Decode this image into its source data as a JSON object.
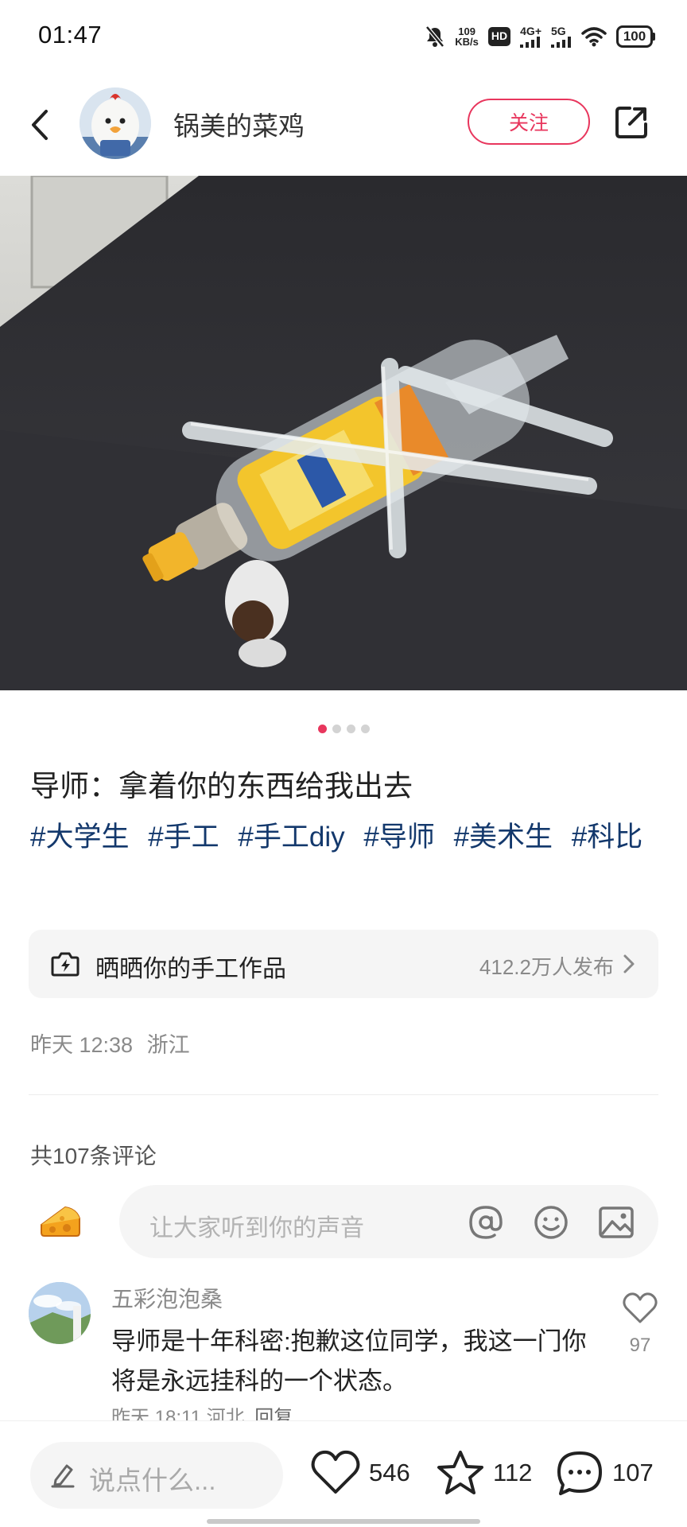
{
  "status_bar": {
    "time": "01:47",
    "net_speed_value": "109",
    "net_speed_unit": "KB/s",
    "hd_label": "HD",
    "signal_4g": "4G+",
    "signal_5g": "5G",
    "battery": "100"
  },
  "header": {
    "author_name": "锅美的菜鸡",
    "follow_label": "关注"
  },
  "carousel": {
    "total": 4,
    "active_index": 0
  },
  "post": {
    "title": "导师：拿着你的东西给我出去",
    "tags": [
      "#大学生",
      "#手工",
      "#手工diy",
      "#导师",
      "#美术生",
      "#科比"
    ],
    "topic": {
      "label": "晒晒你的手工作品",
      "count": "412.2万人发布"
    },
    "time": "昨天 12:38",
    "location": "浙江"
  },
  "comments": {
    "summary": "共107条评论",
    "input_placeholder": "让大家听到你的声音",
    "items": [
      {
        "user": "五彩泡泡桑",
        "text": "导师是十年科密:抱歉这位同学，我这一门你将是永远挂科的一个状态。",
        "time": "昨天 18:11",
        "location": "河北",
        "reply_label": "回复",
        "likes": "97"
      }
    ]
  },
  "bottom_bar": {
    "say_placeholder": "说点什么...",
    "likes": "546",
    "stars": "112",
    "comments": "107"
  },
  "colors": {
    "accent": "#e8365d",
    "tag": "#13386c",
    "muted": "#8a8a8a"
  }
}
